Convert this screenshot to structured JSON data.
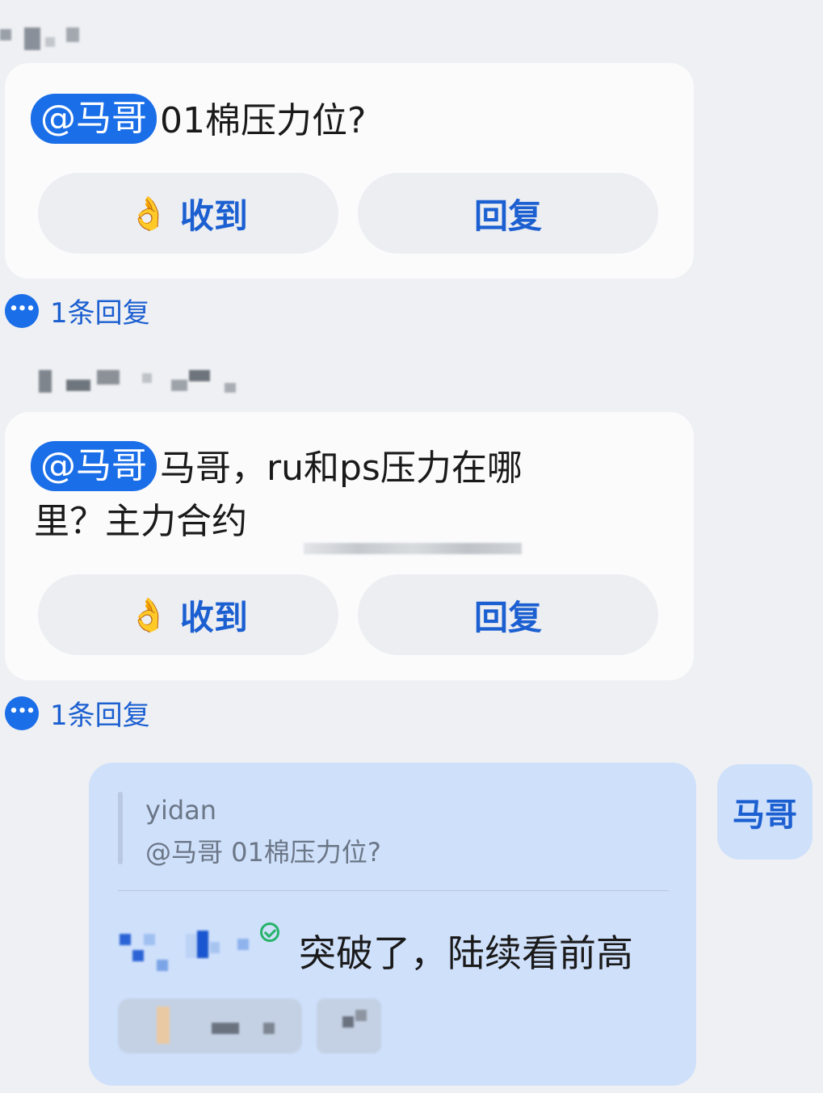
{
  "messages": [
    {
      "mention": "@马哥",
      "text": "01棉压力位?",
      "ack_label": "收到",
      "ack_emoji": "👌",
      "reply_label": "回复",
      "thread_count": "1条回复"
    },
    {
      "mention": "@马哥",
      "text_line1": "马哥，ru和ps压力在哪",
      "text_line2": "里？主力合约",
      "ack_label": "收到",
      "ack_emoji": "👌",
      "reply_label": "回复",
      "thread_count": "1条回复"
    }
  ],
  "own_message": {
    "quote_author": "yidan",
    "quote_text": "@马哥 01棉压力位?",
    "text": "突破了，陆续看前高"
  },
  "avatar_label": "马哥",
  "colors": {
    "accent": "#1a6ee8",
    "background": "#eef0f3",
    "own_bubble": "#cfe0fb"
  }
}
